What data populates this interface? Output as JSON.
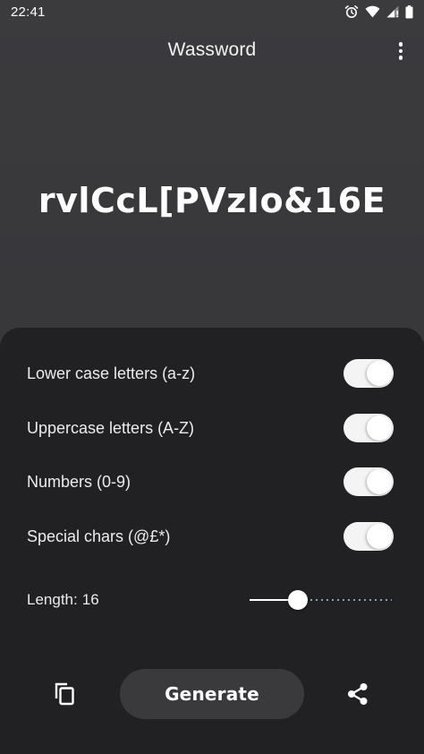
{
  "status_bar": {
    "time": "22:41",
    "icons": [
      "alarm-icon",
      "wifi-icon",
      "signal-icon",
      "battery-icon"
    ]
  },
  "app_bar": {
    "title": "Wassword",
    "menu_icon": "more-vert-icon"
  },
  "password": "rvlCcL[PVzIo&16E",
  "options": [
    {
      "id": "lowercase",
      "label": "Lower case letters (a-z)",
      "enabled": true
    },
    {
      "id": "uppercase",
      "label": "Uppercase letters (A-Z)",
      "enabled": true
    },
    {
      "id": "numbers",
      "label": "Numbers (0-9)",
      "enabled": true
    },
    {
      "id": "special",
      "label": "Special chars (@£*)",
      "enabled": true
    }
  ],
  "length": {
    "label": "Length:",
    "value": "16",
    "slider_fraction": 0.34
  },
  "actions": {
    "copy_icon": "copy-icon",
    "generate_label": "Generate",
    "share_icon": "share-icon"
  },
  "colors": {
    "background": "#3a3a3d",
    "panel": "#212124",
    "button": "#3a3a3d",
    "slider_inactive": "#8fb0c8"
  }
}
